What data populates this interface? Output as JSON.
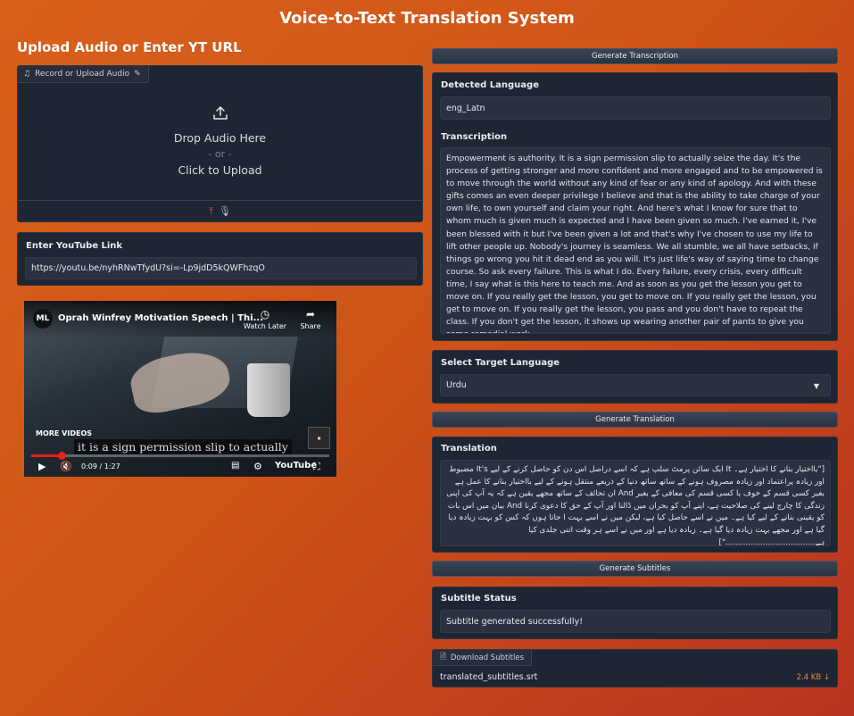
{
  "app": {
    "title": "Voice-to-Text Translation System"
  },
  "left": {
    "section_title": "Upload Audio or Enter YT URL",
    "upload": {
      "chip_label": "Record or Upload Audio",
      "drop_text": "Drop Audio Here",
      "or_text": "- or -",
      "click_text": "Click to Upload"
    },
    "youtube": {
      "label": "Enter YouTube Link",
      "value": "https://youtu.be/nyhRNwTfydU?si=-Lp9jdD5kQWFhzqO"
    },
    "video": {
      "channel_initials": "ML",
      "title": "Oprah Winfrey Motivation Speech | Thi...",
      "watch_later": "Watch Later",
      "share": "Share",
      "more_videos": "MORE VIDEOS",
      "caption": "it is a sign permission slip to actually",
      "time": "0:09 / 1:27",
      "progress": 0.103,
      "brand": "YouTube"
    }
  },
  "right": {
    "generate_transcription": "Generate Transcription",
    "detected_language": {
      "label": "Detected Language",
      "value": "eng_Latn"
    },
    "transcription": {
      "label": "Transcription",
      "text": " Empowerment is authority. It is a sign permission slip to actually seize the day. It's the process of getting stronger and more confident and more engaged and to be empowered is to move through the world without any kind of fear or any kind of apology. And with these gifts comes an even deeper privilege I believe and that is the ability to take charge of your own life, to own yourself and claim your right. And here's what I know for sure that to whom much is given much is expected and I have been given so much. I've earned it, I've been blessed with it but I've been given a lot and that's why I've chosen to use my life to lift other people up. Nobody's journey is seamless. We all stumble, we all have setbacks, if things go wrong you hit it dead end as you will. It's just life's way of saying time to change course. So ask every failure. This is what I do. Every failure, every crisis, every difficult time, I say what is this here to teach me. And as soon as you get the lesson you get to move on. If you really get the lesson, you get to move on. If you really get the lesson, you get to move on. If you really get the lesson, you pass and you don't have to repeat the class. If you don't get the lesson, it shows up wearing another pair of pants to give you some remedial work."
    },
    "target_language": {
      "label": "Select Target Language",
      "value": "Urdu"
    },
    "generate_translation": "Generate Translation",
    "translation": {
      "label": "Translation",
      "text": "[\"بااختیار بنانے کا اختیار ہے۔ It ایک سائن پرمٹ سلپ ہے کہ اسے دراصل اس دن کو حاصل کرنے کے لیے It's مضبوط اور زیادہ پراعتماد اور زیادہ مصروف ہونے کے ساتھ ساتھ دنیا کے ذریعے منتقل ہونے کے لیے بااختیار بنانے کا عمل ہے بغیر کسی قسم کے خوف یا کسی قسم کی معافی کے بغیر And ان تحائف کے ساتھ مجھے یقین ہے کہ یہ آپ کی اپنی زندگی کا چارج لینے کی صلاحیت ہے، اپنے آپ کو بحران میں ڈالنا اور آپ کے حق کا دعوی کرنا And بیان میں اس بات کو یقینی بنانے کے لیے کیا ہے۔ میں نے اسے حاصل کیا ہے، لیکن میں نے اسے بہت ا جاتا ہوں کہ کس کو بہت زیادہ دیا گیا ہے اور مجھے بہت زیادہ دیا گیا ہے۔ زیادہ دیا ہے اور میں نے اسے ہر وقت اتنی جلدی کیا ہے....................................\"]"
    },
    "generate_subtitles": "Generate Subtitles",
    "subtitle_status": {
      "label": "Subtitle Status",
      "value": "Subtitle generated successfully!"
    },
    "download": {
      "chip_label": "Download Subtitles",
      "file_name": "translated_subtitles.srt",
      "file_size": "2.4 KB ↓"
    }
  }
}
